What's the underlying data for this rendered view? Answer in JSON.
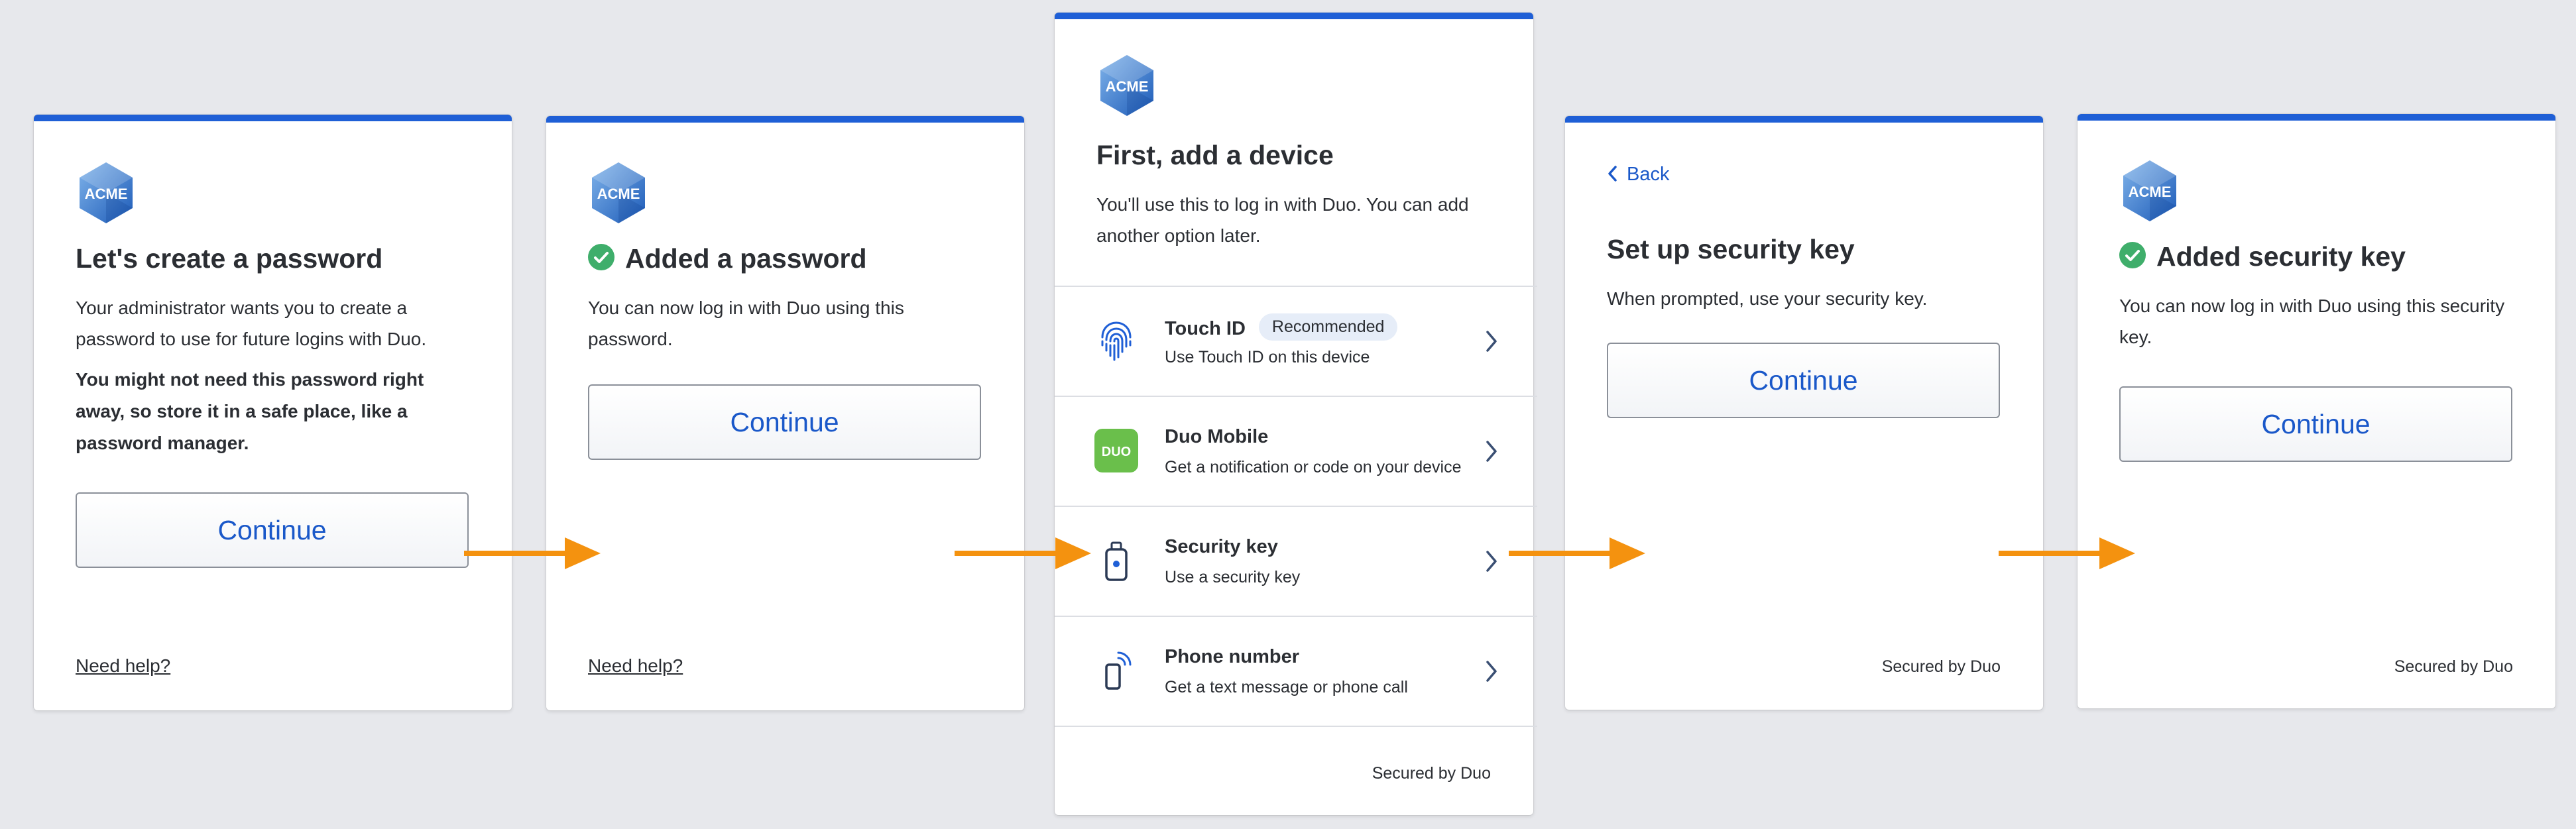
{
  "logo_text": "ACME",
  "colors": {
    "accent": "#1f5fd6",
    "link": "#1a58c9",
    "arrow": "#f4920f",
    "success": "#3fae6b",
    "duo_green": "#6abf4b"
  },
  "card1": {
    "title": "Let's create a password",
    "line1": "Your administrator wants you to create a",
    "line2": "password to use for future logins with Duo.",
    "bold1": "You might not need this password right",
    "bold2": "away, so store it in a safe place, like a",
    "bold3": "password manager.",
    "button": "Continue",
    "help": "Need help?"
  },
  "card2": {
    "title": "Added a password",
    "line1": "You can now log in with Duo using this",
    "line2": "password.",
    "button": "Continue",
    "help": "Need help?"
  },
  "card3": {
    "title": "First, add a device",
    "line1": "You'll use this to log in with Duo. You can add",
    "line2": "another option later.",
    "devices": [
      {
        "name": "Touch ID",
        "badge": "Recommended",
        "sub": "Use Touch ID on this device",
        "icon": "fingerprint-icon"
      },
      {
        "name": "Duo Mobile",
        "sub": "Get a notification or code on your device",
        "icon": "duo-mobile-icon",
        "icon_text": "DUO"
      },
      {
        "name": "Security key",
        "sub": "Use a security key",
        "icon": "security-key-icon"
      },
      {
        "name": "Phone number",
        "sub": "Get a text message or phone call",
        "icon": "phone-icon"
      }
    ],
    "secured": "Secured by Duo"
  },
  "card4": {
    "back": "Back",
    "title": "Set up security key",
    "line1": "When prompted, use your security key.",
    "button": "Continue",
    "secured": "Secured by Duo"
  },
  "card5": {
    "title": "Added security key",
    "line1": "You can now log in with Duo using this security",
    "line2": "key.",
    "button": "Continue",
    "secured": "Secured by Duo"
  }
}
